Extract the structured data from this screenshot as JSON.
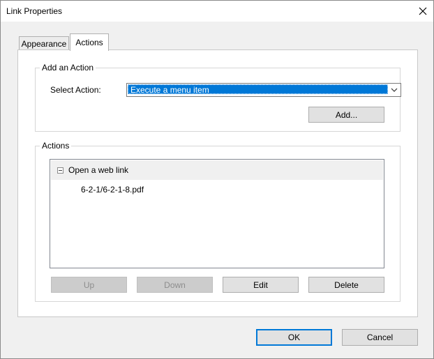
{
  "window": {
    "title": "Link Properties"
  },
  "tabs": [
    {
      "label": "Appearance"
    },
    {
      "label": "Actions"
    }
  ],
  "add_action": {
    "group_label": "Add an Action",
    "select_label": "Select Action:",
    "select_value": "Execute a menu item",
    "add_button": "Add..."
  },
  "actions": {
    "group_label": "Actions",
    "tree": [
      {
        "label": "Open a web link",
        "children": [
          "6-2-1/6-2-1-8.pdf"
        ]
      }
    ],
    "buttons": {
      "up": "Up",
      "down": "Down",
      "edit": "Edit",
      "delete": "Delete"
    }
  },
  "footer": {
    "ok": "OK",
    "cancel": "Cancel"
  },
  "colors": {
    "selection": "#0078d7",
    "default_button_border": "#0078d7"
  },
  "icons": {
    "close": "close-icon",
    "dropdown": "chevron-down-icon",
    "collapse": "minus-box-icon"
  }
}
